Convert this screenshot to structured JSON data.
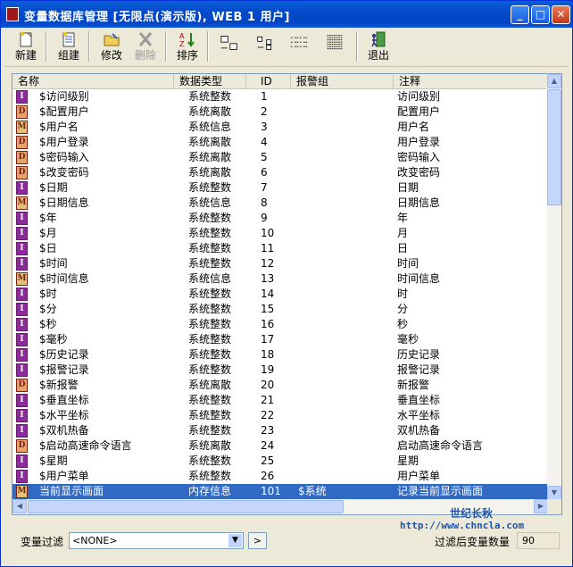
{
  "window": {
    "title": "变量数据库管理 [无限点(演示版), WEB 1 用户]"
  },
  "toolbar": [
    {
      "name": "new-button",
      "label": "新建",
      "icon": "new-doc-icon",
      "enabled": true
    },
    {
      "name": "group-button",
      "label": "组建",
      "icon": "group-doc-icon",
      "enabled": true
    },
    {
      "name": "edit-button",
      "label": "修改",
      "icon": "folder-edit-icon",
      "enabled": true
    },
    {
      "name": "delete-button",
      "label": "删除",
      "icon": "delete-x-icon",
      "enabled": false
    },
    {
      "name": "sort-button",
      "label": "排序",
      "icon": "sort-az-icon",
      "enabled": true
    },
    {
      "name": "exit-button",
      "label": "退出",
      "icon": "exit-door-icon",
      "enabled": true
    }
  ],
  "columns": [
    "名称",
    "数据类型",
    "ID",
    "报警组",
    "注释"
  ],
  "rows": [
    {
      "icon": "I",
      "name": "$访问级别",
      "type": "系统整数",
      "id": "1",
      "group": "",
      "note": "访问级别"
    },
    {
      "icon": "D",
      "name": "$配置用户",
      "type": "系统离散",
      "id": "2",
      "group": "",
      "note": "配置用户"
    },
    {
      "icon": "M",
      "name": "$用户名",
      "type": "系统信息",
      "id": "3",
      "group": "",
      "note": "用户名"
    },
    {
      "icon": "D",
      "name": "$用户登录",
      "type": "系统离散",
      "id": "4",
      "group": "",
      "note": "用户登录"
    },
    {
      "icon": "D",
      "name": "$密码输入",
      "type": "系统离散",
      "id": "5",
      "group": "",
      "note": "密码输入"
    },
    {
      "icon": "D",
      "name": "$改变密码",
      "type": "系统离散",
      "id": "6",
      "group": "",
      "note": "改变密码"
    },
    {
      "icon": "I",
      "name": "$日期",
      "type": "系统整数",
      "id": "7",
      "group": "",
      "note": "日期"
    },
    {
      "icon": "M",
      "name": "$日期信息",
      "type": "系统信息",
      "id": "8",
      "group": "",
      "note": "日期信息"
    },
    {
      "icon": "I",
      "name": "$年",
      "type": "系统整数",
      "id": "9",
      "group": "",
      "note": "年"
    },
    {
      "icon": "I",
      "name": "$月",
      "type": "系统整数",
      "id": "10",
      "group": "",
      "note": "月"
    },
    {
      "icon": "I",
      "name": "$日",
      "type": "系统整数",
      "id": "11",
      "group": "",
      "note": "日"
    },
    {
      "icon": "I",
      "name": "$时间",
      "type": "系统整数",
      "id": "12",
      "group": "",
      "note": "时间"
    },
    {
      "icon": "M",
      "name": "$时间信息",
      "type": "系统信息",
      "id": "13",
      "group": "",
      "note": "时间信息"
    },
    {
      "icon": "I",
      "name": "$时",
      "type": "系统整数",
      "id": "14",
      "group": "",
      "note": "时"
    },
    {
      "icon": "I",
      "name": "$分",
      "type": "系统整数",
      "id": "15",
      "group": "",
      "note": "分"
    },
    {
      "icon": "I",
      "name": "$秒",
      "type": "系统整数",
      "id": "16",
      "group": "",
      "note": "秒"
    },
    {
      "icon": "I",
      "name": "$毫秒",
      "type": "系统整数",
      "id": "17",
      "group": "",
      "note": "毫秒"
    },
    {
      "icon": "I",
      "name": "$历史记录",
      "type": "系统整数",
      "id": "18",
      "group": "",
      "note": "历史记录"
    },
    {
      "icon": "I",
      "name": "$报警记录",
      "type": "系统整数",
      "id": "19",
      "group": "",
      "note": "报警记录"
    },
    {
      "icon": "D",
      "name": "$新报警",
      "type": "系统离散",
      "id": "20",
      "group": "",
      "note": "新报警"
    },
    {
      "icon": "I",
      "name": "$垂直坐标",
      "type": "系统整数",
      "id": "21",
      "group": "",
      "note": "垂直坐标"
    },
    {
      "icon": "I",
      "name": "$水平坐标",
      "type": "系统整数",
      "id": "22",
      "group": "",
      "note": "水平坐标"
    },
    {
      "icon": "I",
      "name": "$双机热备",
      "type": "系统整数",
      "id": "23",
      "group": "",
      "note": "双机热备"
    },
    {
      "icon": "D",
      "name": "$启动高速命令语言",
      "type": "系统离散",
      "id": "24",
      "group": "",
      "note": "启动高速命令语言"
    },
    {
      "icon": "I",
      "name": "$星期",
      "type": "系统整数",
      "id": "25",
      "group": "",
      "note": "星期"
    },
    {
      "icon": "I",
      "name": "$用户菜单",
      "type": "系统整数",
      "id": "26",
      "group": "",
      "note": "用户菜单"
    },
    {
      "icon": "M",
      "name": "当前显示画面",
      "type": "内存信息",
      "id": "101",
      "group": "$系统",
      "note": "记录当前显示画面",
      "selected": true
    }
  ],
  "filter": {
    "label": "变量过滤",
    "value": "<NONE>",
    "go_label": ">"
  },
  "brand": {
    "name": "世纪长秋",
    "url": "http://www.chncla.com"
  },
  "count": {
    "label": "过滤后变量数量",
    "value": "90"
  }
}
